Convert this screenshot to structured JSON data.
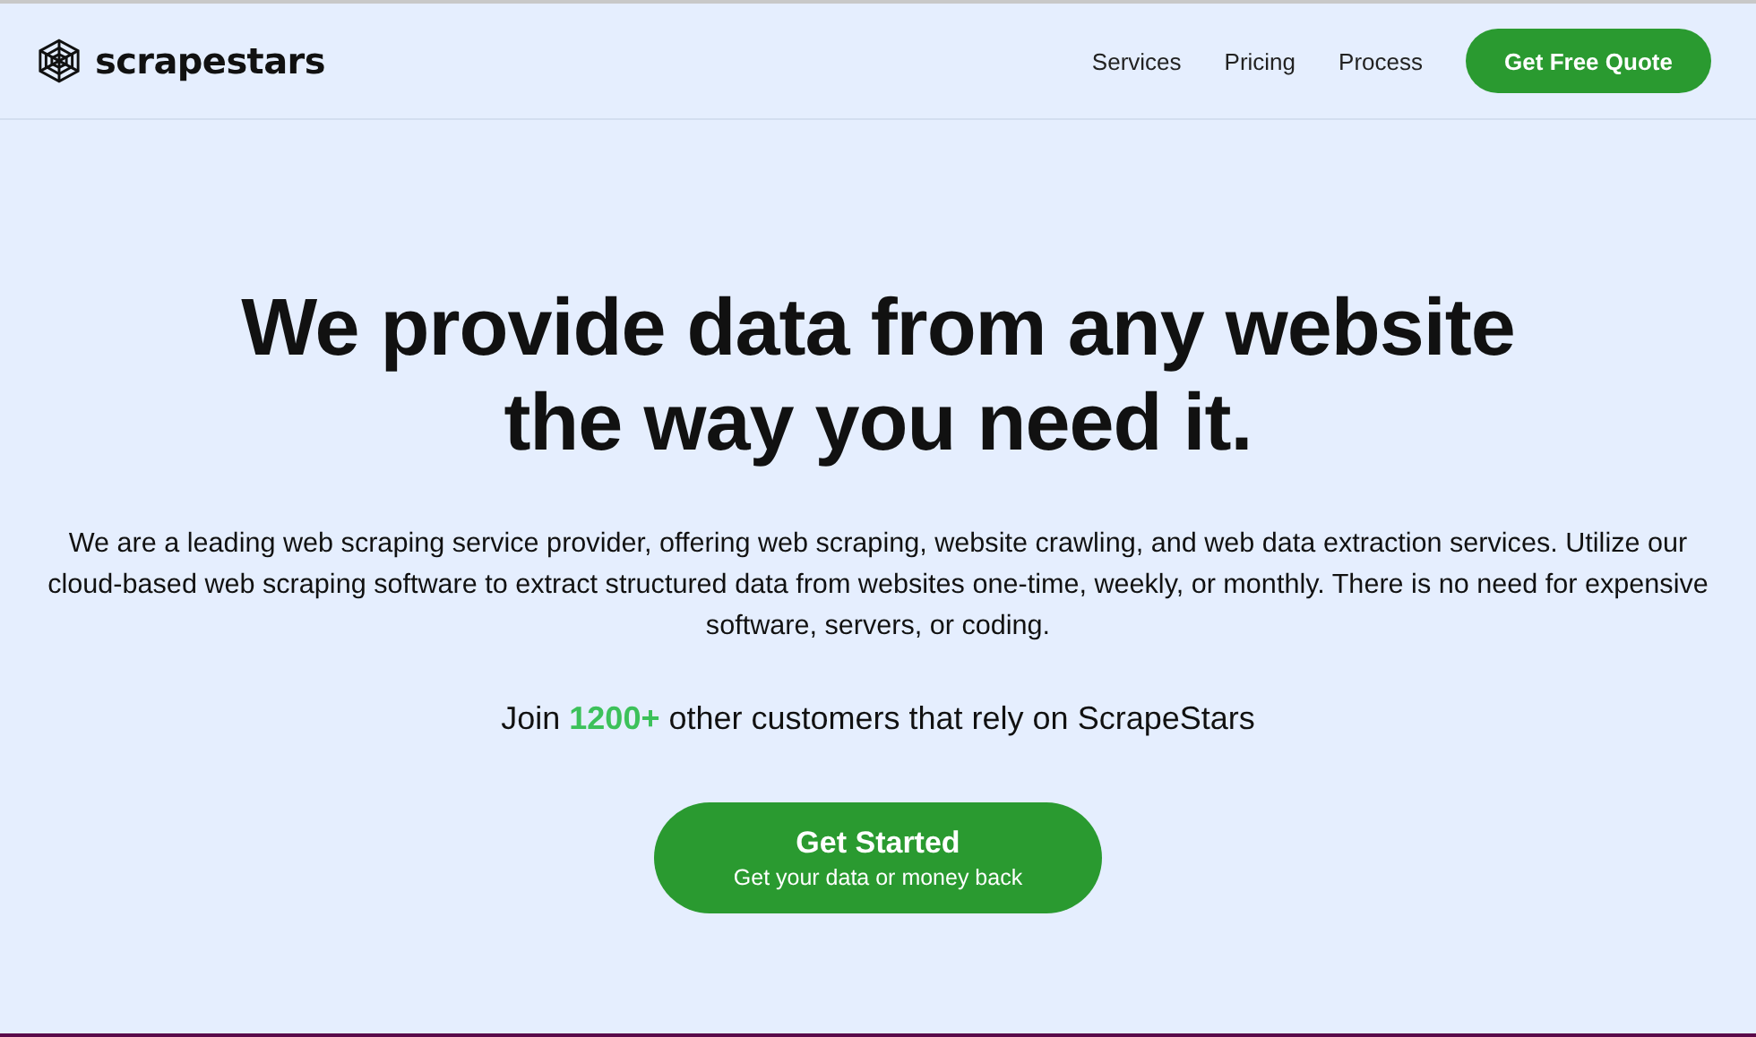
{
  "header": {
    "logo": "scrapestars",
    "nav": [
      "Services",
      "Pricing",
      "Process"
    ],
    "cta": "Get Free Quote"
  },
  "hero": {
    "headline_lines": [
      "We provide data from any website",
      "the way you need it."
    ],
    "description": "We are a leading web scraping service provider, offering web scraping, website crawling, and web data extraction services. Utilize our cloud-based web scraping software to extract structured data from websites one-time, weekly, or monthly. There is no need for expensive software, servers, or coding.",
    "join": {
      "prefix": "Join ",
      "highlight": "1200+",
      "suffix": " other customers that rely on ScrapeStars"
    },
    "button": {
      "title": "Get Started",
      "subtitle": "Get your data or money back"
    }
  }
}
